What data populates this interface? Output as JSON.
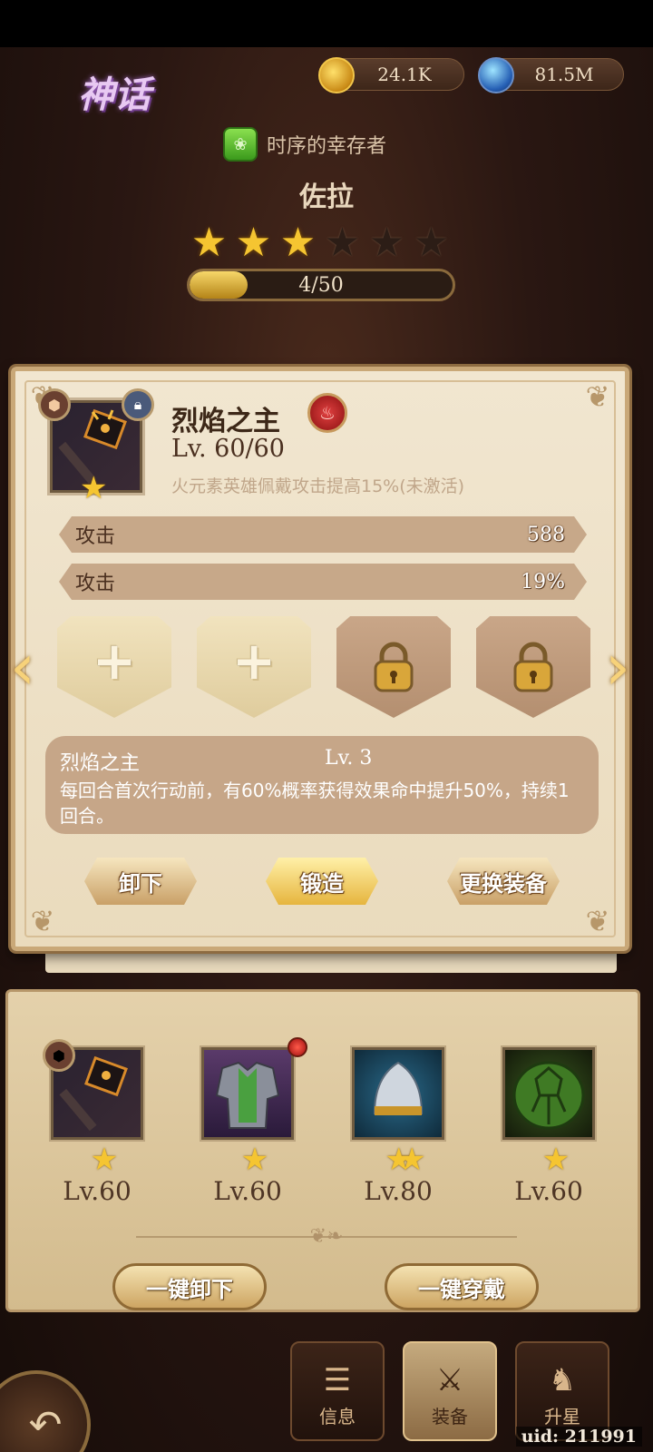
{
  "header": {
    "rarity": "神话",
    "currency": [
      {
        "icon": "gold-coin-icon",
        "value": "24.1K"
      },
      {
        "icon": "blue-gem-icon",
        "value": "81.5M"
      }
    ],
    "faction": "时序的幸存者",
    "hero_name": "佐拉",
    "stars_filled": 3,
    "stars_total": 6,
    "progress_text": "4/50",
    "progress_fraction": 0.08
  },
  "modal": {
    "item_name": "烈焰之主",
    "level": "Lv. 60/60",
    "bonus_text": "火元素英雄佩戴攻击提高15%(未激活)",
    "item_stars": 1,
    "stats": [
      {
        "label": "攻击",
        "value": "588"
      },
      {
        "label": "攻击",
        "value": "19%"
      }
    ],
    "gem_slots": [
      {
        "state": "empty",
        "icon": "plus-icon"
      },
      {
        "state": "empty",
        "icon": "plus-icon"
      },
      {
        "state": "locked",
        "icon": "padlock-icon"
      },
      {
        "state": "locked",
        "icon": "padlock-icon"
      }
    ],
    "skill": {
      "name": "烈焰之主",
      "level": "Lv. 3",
      "description": "每回合首次行动前，有60%概率获得效果命中提升50%，持续1回合。"
    },
    "buttons": {
      "unequip": "卸下",
      "forge": "锻造",
      "replace": "更换装备"
    }
  },
  "inventory": {
    "slots": [
      {
        "name": "hammer",
        "level": "Lv.60",
        "stars": "★"
      },
      {
        "name": "armor",
        "level": "Lv.60",
        "stars": "★"
      },
      {
        "name": "helmet",
        "level": "Lv.80",
        "stars": "★★"
      },
      {
        "name": "shell",
        "level": "Lv.60",
        "stars": "★"
      }
    ],
    "buttons": {
      "unequip_all": "一键卸下",
      "equip_all": "一键穿戴"
    }
  },
  "nav": {
    "tabs": [
      {
        "label": "信息",
        "icon": "info-icon"
      },
      {
        "label": "装备",
        "icon": "equipment-icon"
      },
      {
        "label": "升星",
        "icon": "star-up-icon"
      }
    ]
  },
  "uid": "uid: 211991",
  "colors": {
    "panel": "#eadbbd",
    "stat_bar": "#c7a889",
    "gold_star": "#f5c531",
    "accent_red": "#e04040"
  }
}
